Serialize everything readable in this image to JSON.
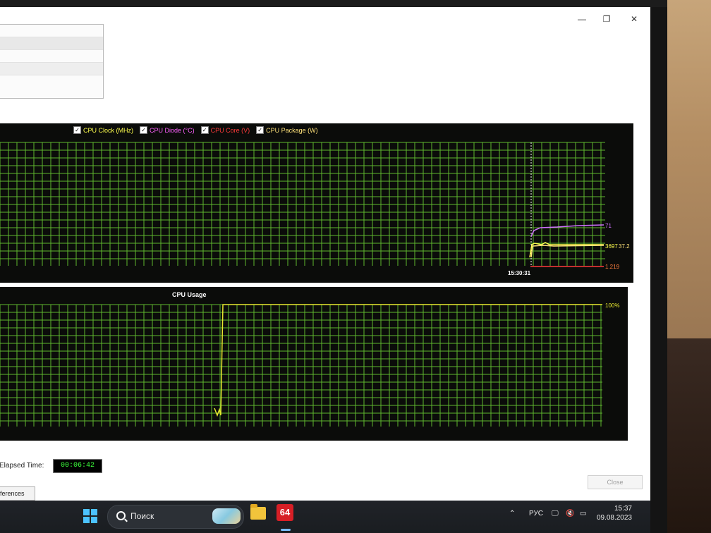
{
  "window": {
    "minimize_glyph": "—",
    "maximize_glyph": "❐",
    "close_glyph": "✕"
  },
  "legend": [
    {
      "label": "CPU Clock (MHz)",
      "color": "#ffff4d",
      "checked": true
    },
    {
      "label": "CPU Diode (°C)",
      "color": "#ff60ff",
      "checked": true
    },
    {
      "label": "CPU Core (V)",
      "color": "#ff3b3b",
      "checked": true
    },
    {
      "label": "CPU Package (W)",
      "color": "#ffe27a",
      "checked": true
    }
  ],
  "chart_data": [
    {
      "type": "line",
      "title": "",
      "time_label": "15:30:31",
      "series": [
        {
          "name": "CPU Clock (MHz)",
          "color": "#ffff4d",
          "current_label": "3697",
          "values": [
            null,
            3697
          ]
        },
        {
          "name": "CPU Diode (°C)",
          "color": "#d070ff",
          "current_label": "71",
          "values": [
            null,
            71
          ]
        },
        {
          "name": "CPU Core (V)",
          "color": "#ff3b3b",
          "current_label": "1.219",
          "values": [
            null,
            1.219
          ]
        },
        {
          "name": "CPU Package (W)",
          "color": "#ffe27a",
          "current_label": "37.2",
          "values": [
            null,
            37.2
          ]
        }
      ],
      "grid": true
    },
    {
      "type": "line",
      "title": "CPU Usage",
      "ylim": [
        0,
        100
      ],
      "max_label": "100%",
      "grid": true,
      "series": [
        {
          "name": "CPU Usage",
          "color": "#e8e830",
          "values": [
            0,
            100
          ]
        }
      ]
    }
  ],
  "footer": {
    "elapsed_label": "Elapsed Time:",
    "elapsed_value": "00:06:42",
    "preferences_label": "eferences",
    "close_label": "Close"
  },
  "taskbar": {
    "search_placeholder": "Поиск",
    "app_label": "64",
    "lang": "РУС",
    "time": "15:37",
    "date": "09.08.2023"
  }
}
